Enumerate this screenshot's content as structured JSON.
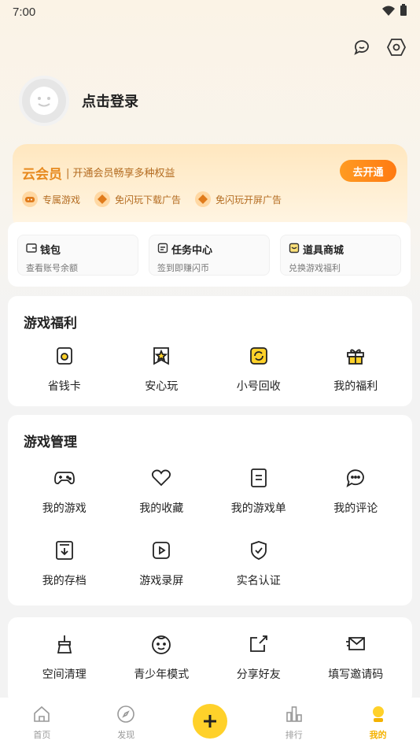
{
  "status": {
    "time": "7:00"
  },
  "profile": {
    "login_label": "点击登录"
  },
  "vip": {
    "title": "云会员",
    "subtitle": "| 开通会员畅享多种权益",
    "open_button": "去开通",
    "perks": [
      "专属游戏",
      "免闪玩下载广告",
      "免闪玩开屏广告"
    ]
  },
  "quick": [
    {
      "title": "钱包",
      "sub": "查看账号余额"
    },
    {
      "title": "任务中心",
      "sub": "签到即赚闪币"
    },
    {
      "title": "道具商城",
      "sub": "兑换游戏福利"
    }
  ],
  "benefits": {
    "title": "游戏福利",
    "items": [
      "省钱卡",
      "安心玩",
      "小号回收",
      "我的福利"
    ]
  },
  "manage": {
    "title": "游戏管理",
    "row1": [
      "我的游戏",
      "我的收藏",
      "我的游戏单",
      "我的评论"
    ],
    "row2": [
      "我的存档",
      "游戏录屏",
      "实名认证"
    ]
  },
  "tools": {
    "items": [
      "空间清理",
      "青少年模式",
      "分享好友",
      "填写邀请码"
    ]
  },
  "tabs": [
    "首页",
    "发现",
    "排行",
    "我的"
  ],
  "colors": {
    "accent": "#ffd12a",
    "vip": "#e78a1f",
    "active_tab": "#f4b200"
  }
}
